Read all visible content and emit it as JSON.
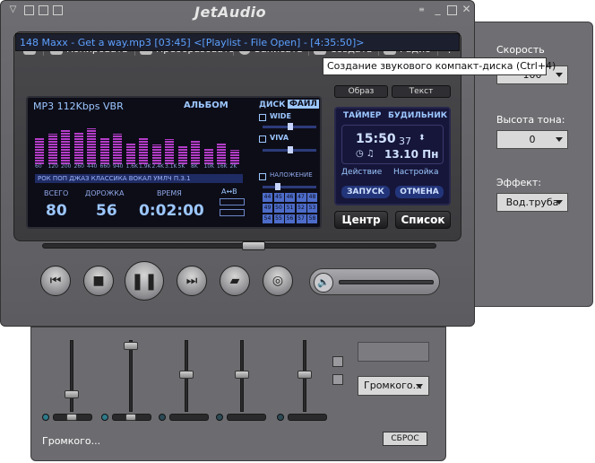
{
  "app": {
    "logo": "JetAudio"
  },
  "toolbar": {
    "items": [
      {
        "label": "Копировать",
        "icon": "copy-icon"
      },
      {
        "label": "Преобразовать",
        "icon": "convert-icon"
      },
      {
        "label": "Записать",
        "icon": "burn-icon"
      },
      {
        "label": "Создать",
        "icon": "create-cd-icon"
      },
      {
        "label": "Радио",
        "icon": "radio-icon"
      }
    ]
  },
  "track": {
    "line": "148 Maxx - Get a way.mp3 [03:45]      <[Playlist - File Open] - [4:35:50]>"
  },
  "tooltip": "Создание звукового компакт-диска (Ctrl+4)",
  "tabs": {
    "image": "Образ",
    "text": "Текст"
  },
  "lcd": {
    "format": "MP3 112Kbps VBR",
    "album_label": "АЛЬБОМ",
    "disk": "ДИСК",
    "file": "ФАЙЛ",
    "freqs": [
      "60",
      "120",
      "200",
      "260",
      "440",
      "660",
      "940",
      "1.6K",
      "1.9K",
      "2.4K",
      "3.1K",
      "5K",
      "8K",
      "10K",
      "16K",
      "2K"
    ],
    "genres": "РОК  ПОП  ДЖАЗ  КЛАССИКА  ВОКАЛ  УМЛЧ  П.З.1",
    "total_label": "ВСЕГО",
    "track_label": "ДОРОЖКА",
    "time_label": "ВРЕМЯ",
    "total": "80",
    "track": "56",
    "time": "0:02:00",
    "overlay": "НАЛОЖЕНИЕ",
    "wide": "WIDE",
    "viva": "VIVA",
    "ab": "A↔B",
    "grid": [
      "44",
      "45",
      "46",
      "47",
      "48",
      "49",
      "50",
      "51",
      "52",
      "53",
      "54",
      "55",
      "56",
      "57",
      "58"
    ]
  },
  "timer": {
    "timer_label": "ТАЙМЕР",
    "alarm_label": "БУДИЛЬНИК",
    "clock": "15:50",
    "seconds": "37",
    "date": "13.10 Пн",
    "actions": "Действие",
    "settings": "Настройка",
    "start": "ЗАПУСК",
    "cancel": "ОТМЕНА"
  },
  "buttons": {
    "center": "Центр",
    "list": "Список"
  },
  "right_panel": {
    "speed_label": "Скорость",
    "speed_value": "100",
    "pitch_label": "Высота тона:",
    "pitch_value": "0",
    "effect_label": "Эффект:",
    "effect_value": "Вод.труба"
  },
  "eq_panel": {
    "loud_select": "Громкого...",
    "loud_text": "Громкого...",
    "reset": "СБРОС"
  },
  "colors": {
    "accent": "#5da1ff",
    "lcd_bg": "#0d0d18",
    "eq_magenta": "#b43cc8"
  }
}
